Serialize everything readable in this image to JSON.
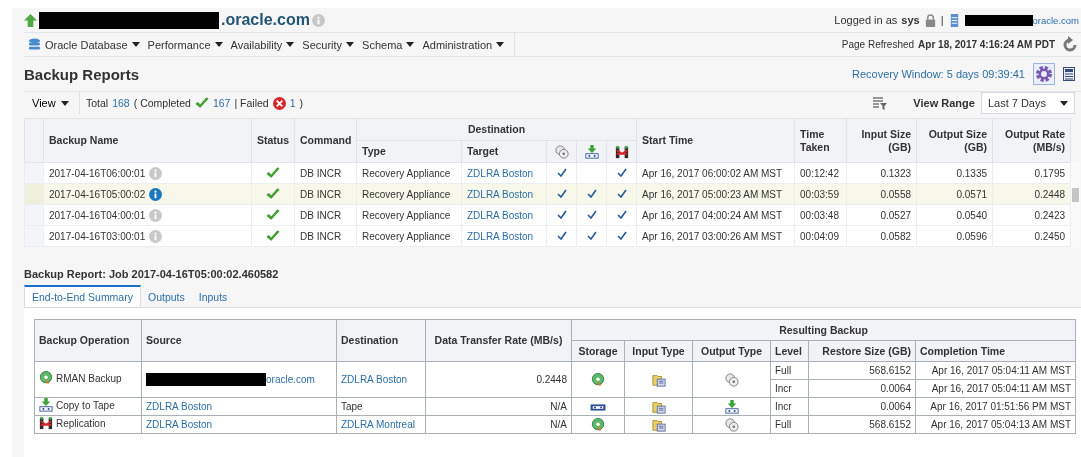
{
  "header": {
    "host_suffix": ".oracle.com",
    "logged_in_label": "Logged in as",
    "user": "sys",
    "separator": "|",
    "host_link_suffix": "oracle.com"
  },
  "menu": [
    {
      "label": "Oracle Database",
      "kind": "database"
    },
    {
      "label": "Performance",
      "kind": "plain"
    },
    {
      "label": "Availability",
      "kind": "plain"
    },
    {
      "label": "Security",
      "kind": "plain"
    },
    {
      "label": "Schema",
      "kind": "plain"
    },
    {
      "label": "Administration",
      "kind": "plain"
    }
  ],
  "page_refreshed": {
    "label": "Page Refreshed",
    "value": "Apr 18, 2017 4:16:24 AM PDT"
  },
  "title": "Backup Reports",
  "recovery_window": "Recovery Window: 5 days 09:39:41",
  "toolbar": {
    "view": "View",
    "view_range_label": "View Range",
    "view_range": "Last 7 Days"
  },
  "summary": [
    {
      "kind": "text",
      "text": "Total"
    },
    {
      "kind": "link",
      "text": "168"
    },
    {
      "kind": "text",
      "text": "( Completed"
    },
    {
      "kind": "ok_icon"
    },
    {
      "kind": "link",
      "text": "167"
    },
    {
      "kind": "text",
      "text": "| Failed"
    },
    {
      "kind": "fail_icon"
    },
    {
      "kind": "link",
      "text": "1"
    },
    {
      "kind": "text",
      "text": ")"
    }
  ],
  "backups": {
    "columns": {
      "name": "Backup Name",
      "status": "Status",
      "command": "Command",
      "destination": "Destination",
      "type": "Type",
      "target": "Target",
      "start_time": "Start Time",
      "time_taken": "Time Taken",
      "input_size": "Input Size (GB)",
      "output_size": "Output Size (GB)",
      "output_rate": "Output Rate (MB/s)"
    },
    "rows": [
      {
        "name": "2017-04-16T06:00:01",
        "selected": false,
        "status": {
          "kind": "completed"
        },
        "command": "DB INCR",
        "type": "Recovery Appliance",
        "target": "ZDLRA Boston",
        "disk": true,
        "tape": false,
        "replication": true,
        "start_time": "Apr 16, 2017 06:00:02 AM MST",
        "time_taken": "00:12:42",
        "input_size": "0.1323",
        "output_size": "0.1335",
        "output_rate": "0.1795"
      },
      {
        "name": "2017-04-16T05:00:02",
        "selected": true,
        "status": {
          "kind": "completed"
        },
        "command": "DB INCR",
        "type": "Recovery Appliance",
        "target": "ZDLRA Boston",
        "disk": true,
        "tape": true,
        "replication": true,
        "start_time": "Apr 16, 2017 05:00:23 AM MST",
        "time_taken": "00:03:59",
        "input_size": "0.0558",
        "output_size": "0.0571",
        "output_rate": "0.2448"
      },
      {
        "name": "2017-04-16T04:00:01",
        "selected": false,
        "status": {
          "kind": "completed"
        },
        "command": "DB INCR",
        "type": "Recovery Appliance",
        "target": "ZDLRA Boston",
        "disk": true,
        "tape": true,
        "replication": true,
        "start_time": "Apr 16, 2017 04:00:24 AM MST",
        "time_taken": "00:03:48",
        "input_size": "0.0527",
        "output_size": "0.0540",
        "output_rate": "0.2423"
      },
      {
        "name": "2017-04-16T03:00:01",
        "selected": false,
        "status": {
          "kind": "completed"
        },
        "command": "DB INCR",
        "type": "Recovery Appliance",
        "target": "ZDLRA Boston",
        "disk": true,
        "tape": true,
        "replication": true,
        "start_time": "Apr 16, 2017 03:00:26 AM MST",
        "time_taken": "00:04:09",
        "input_size": "0.0582",
        "output_size": "0.0596",
        "output_rate": "0.2450"
      }
    ]
  },
  "report": {
    "title": "Backup Report: Job 2017-04-16T05:00:02.460582",
    "tabs": [
      {
        "label": "End-to-End Summary",
        "selected": true
      },
      {
        "label": "Outputs",
        "selected": false
      },
      {
        "label": "Inputs",
        "selected": false
      }
    ],
    "columns": {
      "operation": "Backup Operation",
      "source": "Source",
      "destination": "Destination",
      "rate": "Data Transfer Rate (MB/s)",
      "resulting": "Resulting Backup",
      "storage": "Storage",
      "input_type": "Input Type",
      "output_type": "Output Type",
      "level": "Level",
      "restore_size": "Restore Size (GB)",
      "completion_time": "Completion Time"
    },
    "rows": [
      {
        "kind": "rman",
        "operation": "RMAN Backup",
        "source": "oracle.com",
        "source_redacted": true,
        "destination": "ZDLRA Boston",
        "destination_link": true,
        "rate": "0.2448",
        "storage": {
          "kind": "disk"
        },
        "input_type": {
          "kind": "folder"
        },
        "output_type": {
          "kind": "disk"
        },
        "backups": [
          {
            "level": "Full",
            "restore_size": "568.6152",
            "completion_time": "Apr 16, 2017 05:04:11 AM MST"
          },
          {
            "level": "Incr",
            "restore_size": "0.0064",
            "completion_time": "Apr 16, 2017 05:04:11 AM MST"
          }
        ]
      },
      {
        "kind": "tape",
        "operation": "Copy to Tape",
        "source": "ZDLRA Boston",
        "source_redacted": false,
        "destination": "Tape",
        "destination_link": false,
        "rate": "N/A",
        "storage": {
          "kind": "tape"
        },
        "input_type": {
          "kind": "folder"
        },
        "output_type": {
          "kind": "tape"
        },
        "backups": [
          {
            "level": "Incr",
            "restore_size": "0.0064",
            "completion_time": "Apr 16, 2017 01:51:56 PM MST"
          }
        ]
      },
      {
        "kind": "replication",
        "operation": "Replication",
        "source": "ZDLRA Boston",
        "source_redacted": false,
        "destination": "ZDLRA Montreal",
        "destination_link": true,
        "rate": "N/A",
        "storage": {
          "kind": "disk"
        },
        "input_type": {
          "kind": "folder"
        },
        "output_type": {
          "kind": "disk"
        },
        "backups": [
          {
            "level": "Full",
            "restore_size": "568.6152",
            "completion_time": "Apr 16, 2017 05:04:13 AM MST"
          }
        ]
      }
    ]
  }
}
